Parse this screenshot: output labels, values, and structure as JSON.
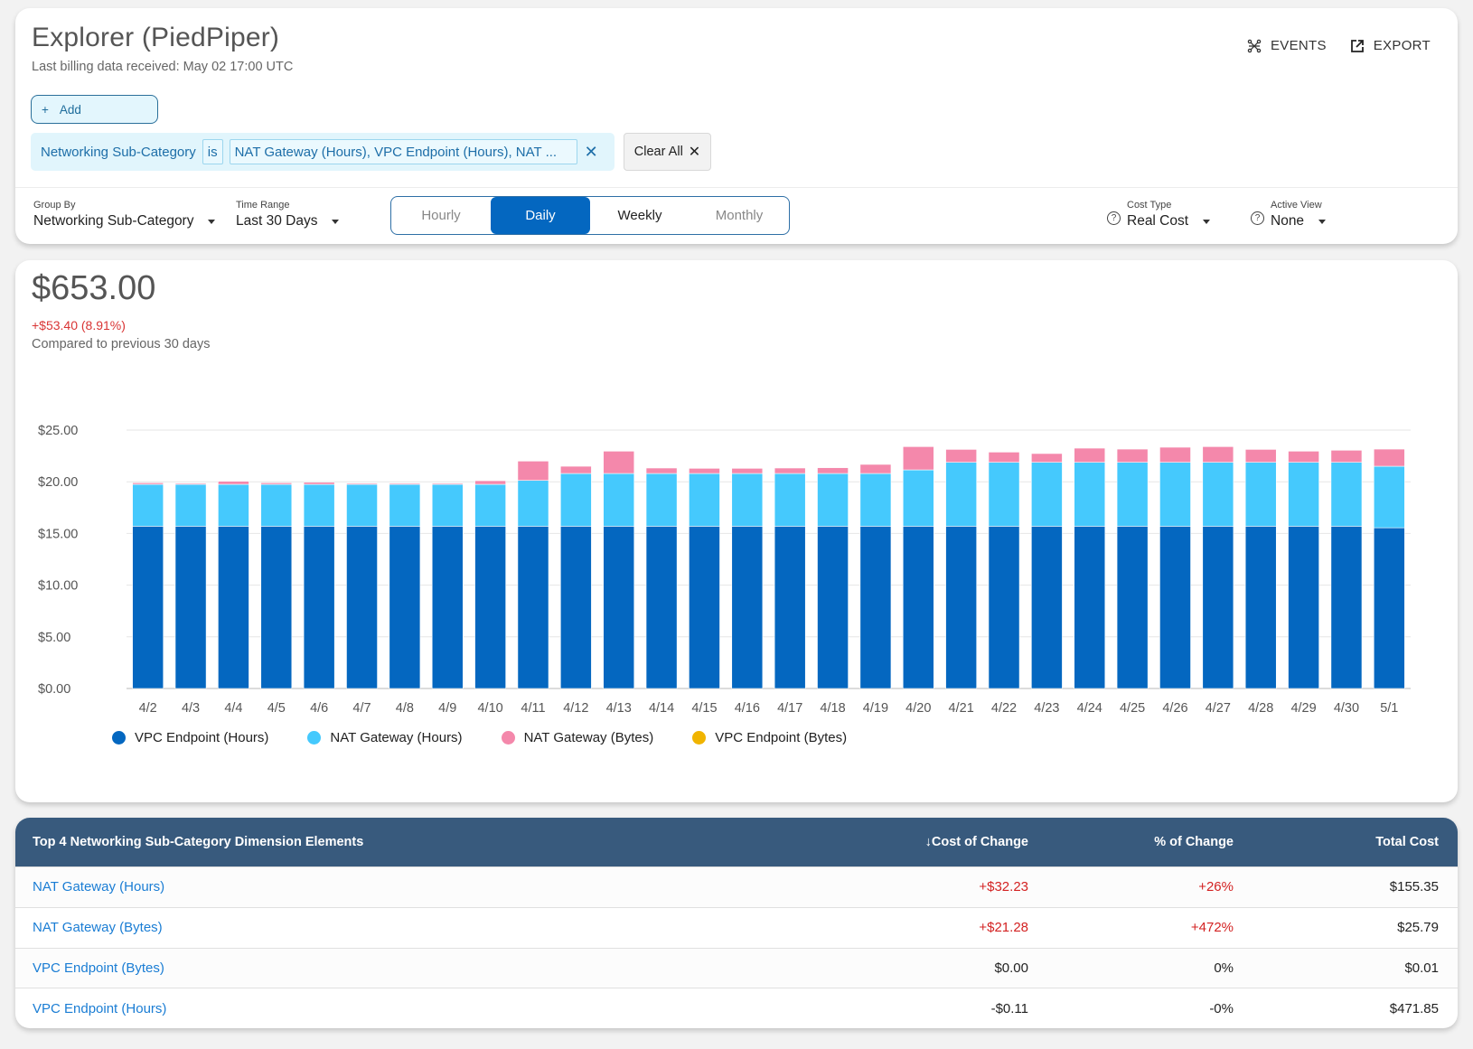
{
  "header": {
    "title": "Explorer (PiedPiper)",
    "subtitle": "Last billing data received: May 02 17:00 UTC",
    "actions": [
      {
        "label": "EVENTS",
        "icon": "events-icon"
      },
      {
        "label": "EXPORT",
        "icon": "export-icon"
      }
    ],
    "add_label": "Add",
    "filter": {
      "key": "Networking Sub-Category",
      "operator": "is",
      "value": "NAT Gateway (Hours), VPC Endpoint (Hours), NAT ..."
    },
    "clear_all_label": "Clear All"
  },
  "controls": {
    "group_by": {
      "label": "Group By",
      "value": "Networking Sub-Category"
    },
    "time_range": {
      "label": "Time Range",
      "value": "Last 30 Days"
    },
    "granularity": {
      "options": [
        "Hourly",
        "Daily",
        "Weekly",
        "Monthly"
      ],
      "selected": "Daily"
    },
    "cost_type": {
      "label": "Cost Type",
      "value": "Real Cost"
    },
    "active_view": {
      "label": "Active View",
      "value": "None"
    }
  },
  "summary": {
    "total": "$653.00",
    "delta": "+$53.40 (8.91%)",
    "compare_text": "Compared to previous 30 days"
  },
  "chart_data": {
    "type": "bar",
    "stacked": true,
    "title": "",
    "xlabel": "",
    "ylabel": "",
    "ylim": [
      0,
      25
    ],
    "yticks": [
      "$0.00",
      "$5.00",
      "$10.00",
      "$15.00",
      "$20.00",
      "$25.00"
    ],
    "grid": true,
    "legend_position": "bottom-left",
    "categories": [
      "4/2",
      "4/3",
      "4/4",
      "4/5",
      "4/6",
      "4/7",
      "4/8",
      "4/9",
      "4/10",
      "4/11",
      "4/12",
      "4/13",
      "4/14",
      "4/15",
      "4/16",
      "4/17",
      "4/18",
      "4/19",
      "4/20",
      "4/21",
      "4/22",
      "4/23",
      "4/24",
      "4/25",
      "4/26",
      "4/27",
      "4/28",
      "4/29",
      "4/30",
      "5/1"
    ],
    "series": [
      {
        "name": "VPC Endpoint (Hours)",
        "color": "#0467c0",
        "values": [
          15.7,
          15.7,
          15.7,
          15.7,
          15.7,
          15.7,
          15.7,
          15.7,
          15.7,
          15.7,
          15.7,
          15.7,
          15.7,
          15.7,
          15.7,
          15.7,
          15.7,
          15.7,
          15.7,
          15.7,
          15.7,
          15.7,
          15.7,
          15.7,
          15.7,
          15.7,
          15.7,
          15.7,
          15.7,
          15.55
        ]
      },
      {
        "name": "NAT Gateway (Hours)",
        "color": "#45c9fd",
        "values": [
          4.05,
          4.05,
          4.05,
          4.05,
          4.05,
          4.05,
          4.05,
          4.05,
          4.05,
          4.43,
          5.1,
          5.1,
          5.1,
          5.1,
          5.1,
          5.1,
          5.1,
          5.1,
          5.45,
          6.18,
          6.18,
          6.18,
          6.18,
          6.18,
          6.18,
          6.18,
          6.18,
          6.18,
          6.18,
          5.95
        ]
      },
      {
        "name": "NAT Gateway (Bytes)",
        "color": "#f488ab",
        "values": [
          0.15,
          0.1,
          0.3,
          0.15,
          0.2,
          0.1,
          0.1,
          0.1,
          0.35,
          1.87,
          0.7,
          2.16,
          0.53,
          0.5,
          0.5,
          0.53,
          0.56,
          0.88,
          2.25,
          1.25,
          0.99,
          0.85,
          1.37,
          1.28,
          1.46,
          1.52,
          1.25,
          1.08,
          1.17,
          1.66
        ]
      },
      {
        "name": "VPC Endpoint (Bytes)",
        "color": "#f0b400",
        "values": [
          0,
          0,
          0,
          0,
          0,
          0,
          0,
          0,
          0,
          0,
          0,
          0,
          0,
          0,
          0,
          0,
          0,
          0,
          0,
          0,
          0,
          0,
          0,
          0,
          0,
          0,
          0,
          0,
          0,
          0
        ]
      }
    ]
  },
  "table": {
    "columns": [
      "Top 4 Networking Sub-Category Dimension Elements",
      "Cost of Change",
      "% of Change",
      "Total Cost"
    ],
    "sort_indicator": "↓",
    "rows": [
      {
        "name": "NAT Gateway (Hours)",
        "cost_change": "+$32.23",
        "pct_change": "+26%",
        "total": "$155.35",
        "trend": "up"
      },
      {
        "name": "NAT Gateway (Bytes)",
        "cost_change": "+$21.28",
        "pct_change": "+472%",
        "total": "$25.79",
        "trend": "up"
      },
      {
        "name": "VPC Endpoint (Bytes)",
        "cost_change": "$0.00",
        "pct_change": "0%",
        "total": "$0.01",
        "trend": "flat"
      },
      {
        "name": "VPC Endpoint (Hours)",
        "cost_change": "-$0.11",
        "pct_change": "-0%",
        "total": "$471.85",
        "trend": "flat"
      }
    ]
  }
}
